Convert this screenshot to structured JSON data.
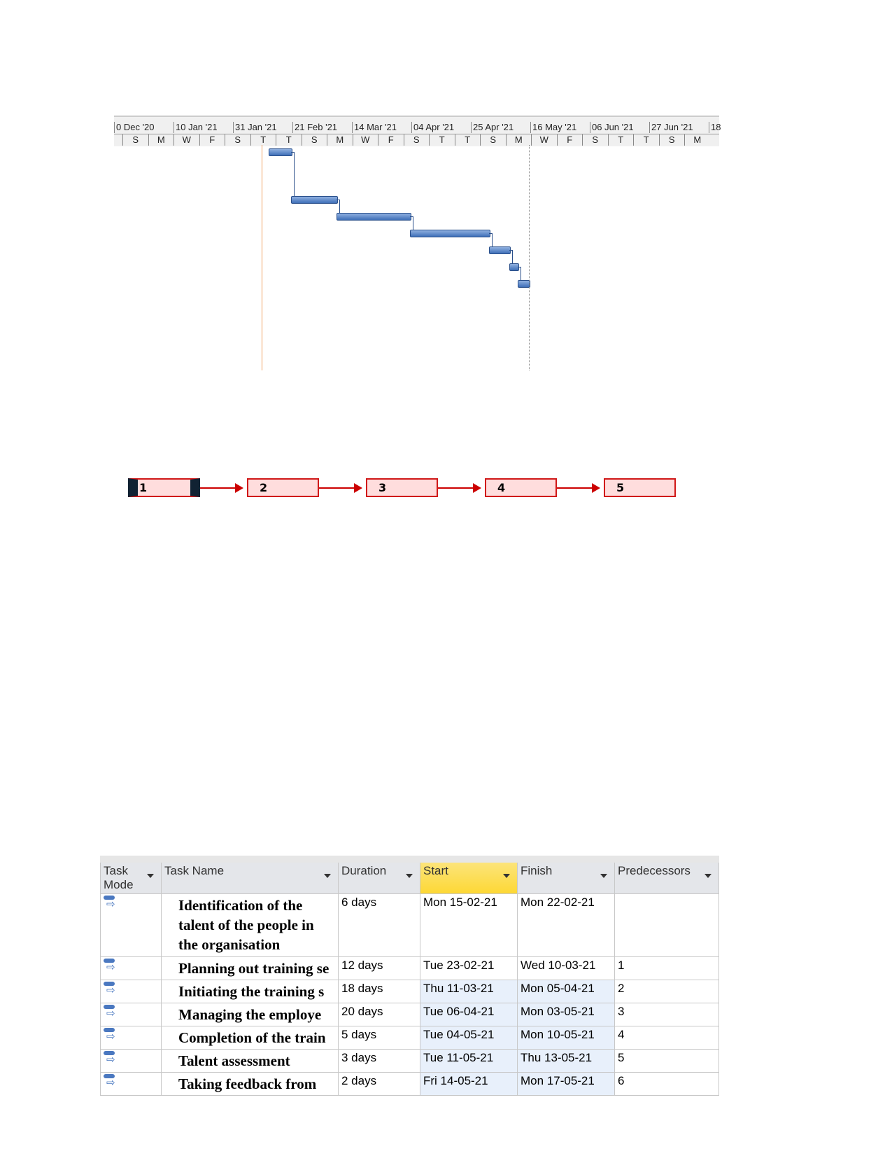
{
  "timeline": {
    "major": [
      "0 Dec '20",
      "10 Jan '21",
      "31 Jan '21",
      "21 Feb '21",
      "14 Mar '21",
      "04 Apr '21",
      "25 Apr '21",
      "16 May '21",
      "06 Jun '21",
      "27 Jun '21",
      "18"
    ],
    "minor": [
      "S",
      "M",
      "W",
      "F",
      "S",
      "T",
      "T",
      "S",
      "M",
      "W",
      "F",
      "S",
      "T",
      "T",
      "S",
      "M",
      "W",
      "F",
      "S",
      "T",
      "T",
      "S",
      "M"
    ]
  },
  "network": {
    "nodes": [
      "1",
      "2",
      "3",
      "4",
      "5"
    ],
    "border_color": "#d01818",
    "fill": "#ffdddd"
  },
  "table": {
    "headers": [
      "Task Mode",
      "Task Name",
      "Duration",
      "Start",
      "Finish",
      "Predecessors"
    ],
    "rows": [
      {
        "name": "Identification of the talent of the people in the organisation",
        "duration": "6 days",
        "start": "Mon 15-02-21",
        "finish": "Mon 22-02-21",
        "pred": ""
      },
      {
        "name": "Planning out training se",
        "duration": "12 days",
        "start": "Tue 23-02-21",
        "finish": "Wed 10-03-21",
        "pred": "1"
      },
      {
        "name": "Initiating the training s",
        "duration": "18 days",
        "start": "Thu 11-03-21",
        "finish": "Mon 05-04-21",
        "pred": "2"
      },
      {
        "name": "Managing the employe",
        "duration": "20 days",
        "start": "Tue 06-04-21",
        "finish": "Mon 03-05-21",
        "pred": "3"
      },
      {
        "name": "Completion of the train",
        "duration": "5 days",
        "start": "Tue 04-05-21",
        "finish": "Mon 10-05-21",
        "pred": "4"
      },
      {
        "name": "Talent assessment",
        "duration": "3 days",
        "start": "Tue 11-05-21",
        "finish": "Thu 13-05-21",
        "pred": "5"
      },
      {
        "name": "Taking feedback from",
        "duration": "2 days",
        "start": "Fri 14-05-21",
        "finish": "Mon 17-05-21",
        "pred": "6"
      }
    ]
  }
}
